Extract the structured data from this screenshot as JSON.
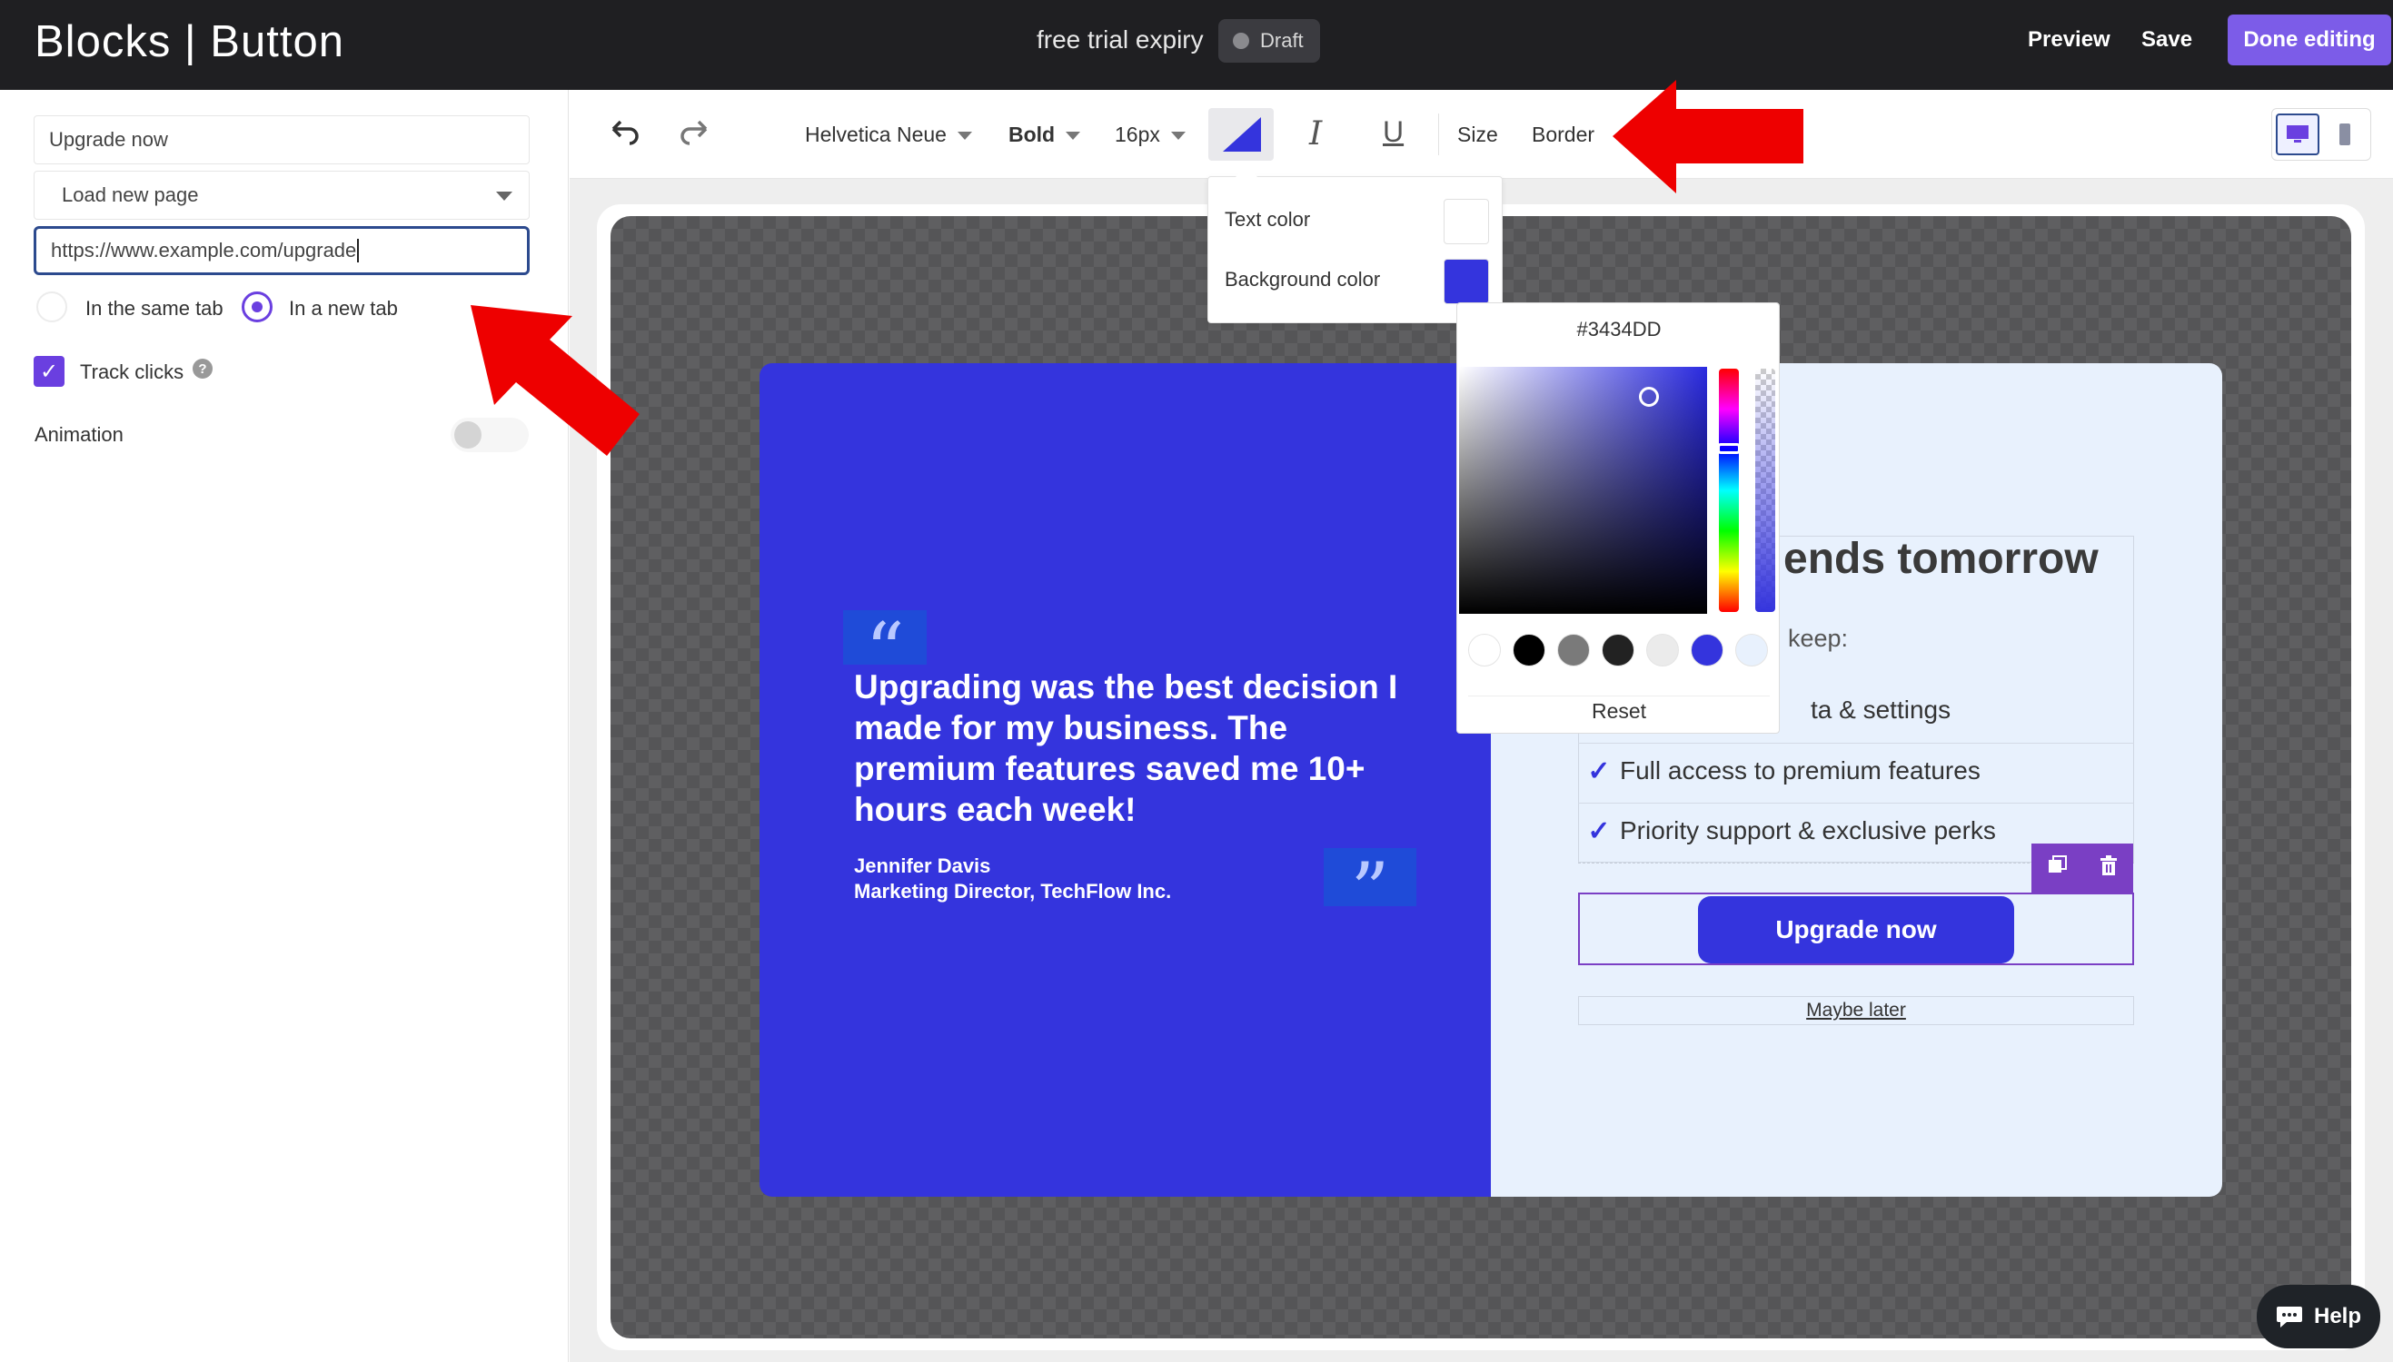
{
  "header": {
    "app_title": "Blocks | Button",
    "doc_name": "free trial expiry",
    "status": "Draft",
    "preview": "Preview",
    "save": "Save",
    "done": "Done editing"
  },
  "left_panel": {
    "button_text": "Upgrade now",
    "action": "Load new page",
    "url": "https://www.example.com/upgrade",
    "open_same_tab": "In the same tab",
    "open_new_tab": "In a new tab",
    "track_clicks": "Track clicks",
    "animation": "Animation"
  },
  "toolbar": {
    "font": "Helvetica Neue",
    "weight": "Bold",
    "size": "16px",
    "size_label": "Size",
    "border_label": "Border"
  },
  "color_menu": {
    "text_color": "Text color",
    "background_color": "Background color",
    "text_color_value": "#FFFFFF",
    "background_color_value": "#3434DD"
  },
  "picker": {
    "hex": "#3434DD",
    "reset": "Reset",
    "presets": [
      "#ffffff",
      "#000000",
      "#7a7a7a",
      "#222222",
      "#ebebeb",
      "#3434dd",
      "#e8f1fd"
    ]
  },
  "card": {
    "quote": "Upgrading was the best decision I made for my business. The premium features saved me 10+ hours each week!",
    "author_name": "Jennifer Davis",
    "author_title": "Marketing Director, TechFlow Inc.",
    "headline": "ends tomorrow",
    "subline": "keep:",
    "bullets": [
      "ta & settings",
      "Full access to premium features",
      "Priority support & exclusive perks"
    ],
    "cta": "Upgrade now",
    "secondary": "Maybe later"
  },
  "help": "Help",
  "colors": {
    "accent": "#7c5ce8",
    "brand_blue": "#3434DD",
    "card_light": "#e8f1fd",
    "annotation_arrow": "#ee0000"
  }
}
